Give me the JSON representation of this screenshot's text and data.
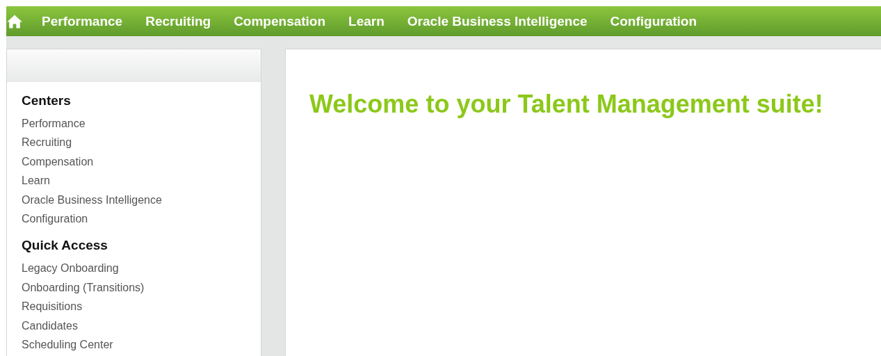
{
  "nav": {
    "items": [
      {
        "label": "Performance"
      },
      {
        "label": "Recruiting"
      },
      {
        "label": "Compensation"
      },
      {
        "label": "Learn"
      },
      {
        "label": "Oracle Business Intelligence"
      },
      {
        "label": "Configuration"
      }
    ]
  },
  "sidebar": {
    "sections": [
      {
        "title": "Centers",
        "items": [
          "Performance",
          "Recruiting",
          "Compensation",
          "Learn",
          "Oracle Business Intelligence",
          "Configuration"
        ]
      },
      {
        "title": "Quick Access",
        "items": [
          "Legacy Onboarding",
          "Onboarding (Transitions)",
          "Requisitions",
          "Candidates",
          "Scheduling Center"
        ]
      }
    ]
  },
  "main": {
    "heading": "Welcome to your Talent Management suite!"
  }
}
